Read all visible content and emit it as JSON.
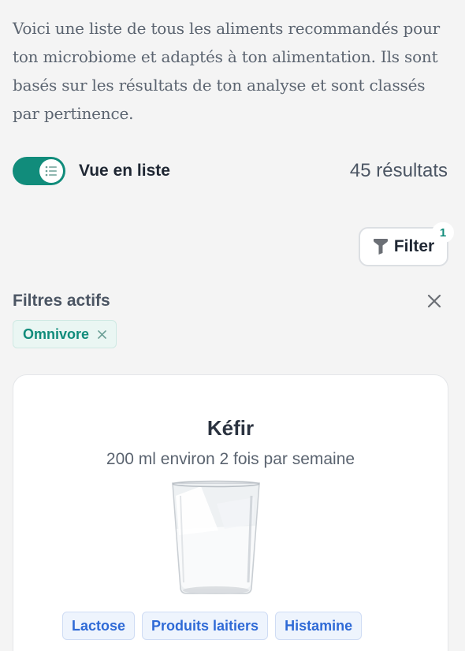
{
  "intro": {
    "text": "Voici une liste de tous les aliments recommandés pour ton microbiome et adaptés à ton alimentation. Ils sont basés sur les résultats de ton analyse et sont classés par pertinence."
  },
  "view_toggle": {
    "label": "Vue en liste",
    "enabled": true,
    "icon": "list-icon"
  },
  "results": {
    "text": "45 résultats"
  },
  "filter_button": {
    "label": "Filter",
    "badge": "1",
    "icon": "funnel-icon"
  },
  "active_filters": {
    "title": "Filtres actifs",
    "chips": [
      {
        "label": "Omnivore"
      }
    ]
  },
  "food_card": {
    "title": "Kéfir",
    "portion": "200 ml environ 2 fois par semaine",
    "image": "glass-of-kefir",
    "tags": [
      "Lactose",
      "Produits laitiers",
      "Histamine"
    ]
  },
  "colors": {
    "accent": "#118c7b",
    "tag_text": "#2f6ad6",
    "background": "#f4f4f4"
  }
}
